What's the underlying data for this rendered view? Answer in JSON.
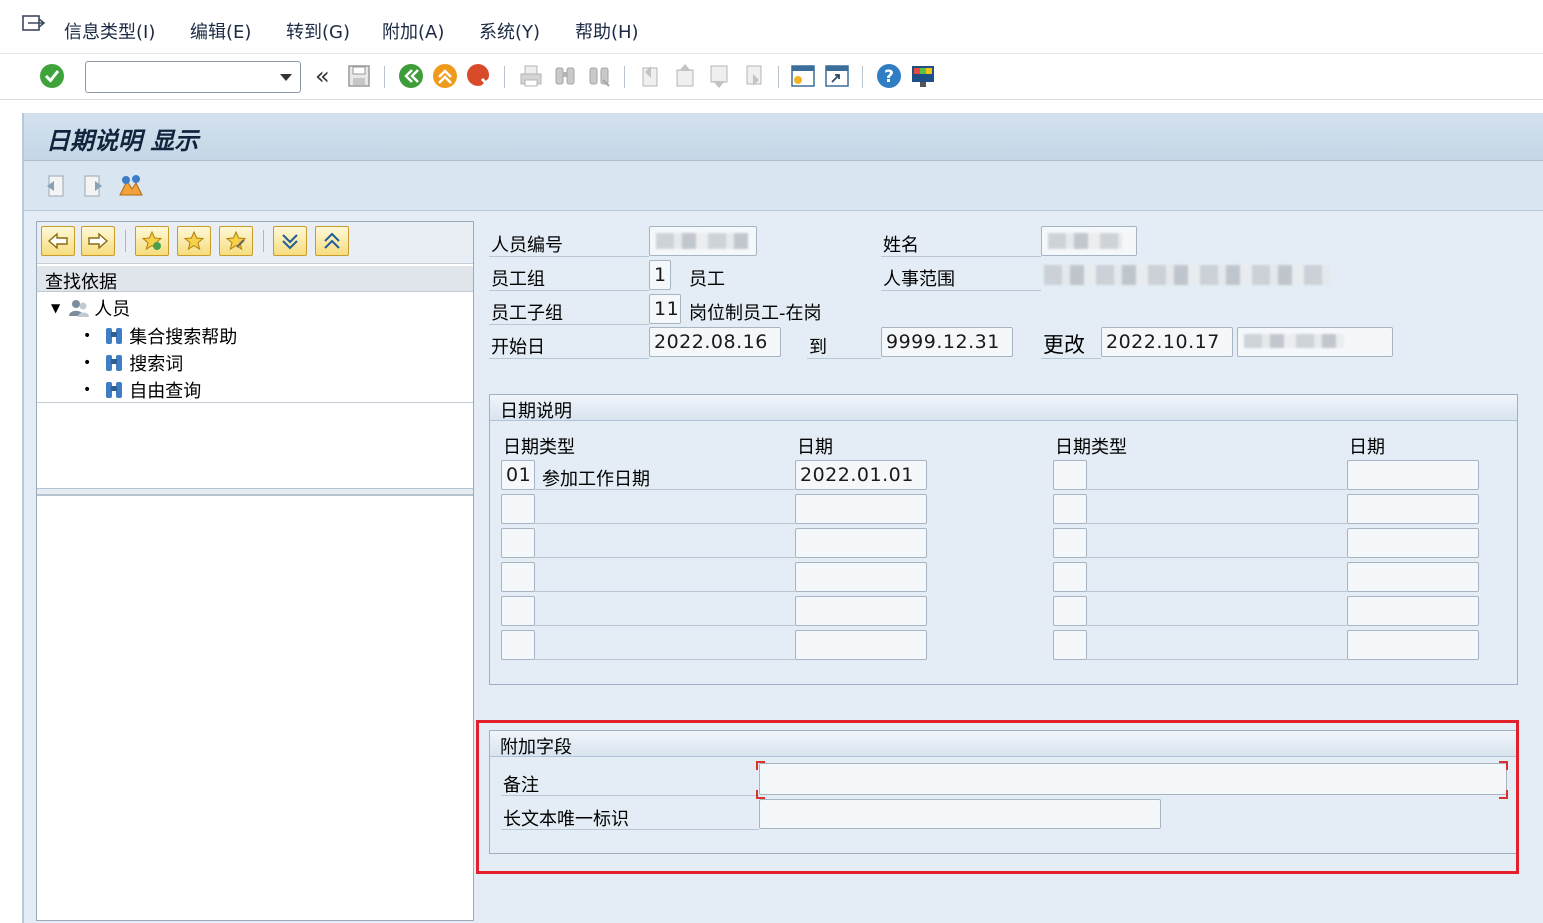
{
  "menubar": {
    "items": [
      "信息类型(I)",
      "编辑(E)",
      "转到(G)",
      "附加(A)",
      "系统(Y)",
      "帮助(H)"
    ]
  },
  "toolbar": {
    "command_field_value": "",
    "icons": [
      "enter-icon",
      "back-double-icon",
      "save-icon",
      "back-icon",
      "exit-icon",
      "cancel-icon",
      "print-icon",
      "find-icon",
      "find-next-icon",
      "first-page-icon",
      "prev-page-icon",
      "next-page-icon",
      "last-page-icon",
      "create-session-icon",
      "shortcut-icon",
      "help-icon",
      "customize-layout-icon"
    ]
  },
  "screen": {
    "title": "日期说明 显示"
  },
  "nav": {
    "tree_header": "查找依据",
    "root": "人员",
    "children": [
      "集合搜索帮助",
      "搜索词",
      "自由查询"
    ]
  },
  "header": {
    "personnel_no_label": "人员编号",
    "name_label": "姓名",
    "ee_group_label": "员工组",
    "ee_group_code": "1",
    "ee_group_text": "员工",
    "pers_area_label": "人事范围",
    "ee_subgroup_label": "员工子组",
    "ee_subgroup_code": "11",
    "ee_subgroup_text": "岗位制员工-在岗",
    "start_label": "开始日",
    "start_value": "2022.08.16",
    "to_label": "到",
    "end_value": "9999.12.31",
    "changed_label": "更改",
    "changed_value": "2022.10.17"
  },
  "dates_group": {
    "title": "日期说明",
    "col_type": "日期类型",
    "col_date": "日期",
    "rows": [
      {
        "type": "01",
        "type_text": "参加工作日期",
        "date": "2022.01.01"
      },
      {
        "type": "",
        "type_text": "",
        "date": ""
      },
      {
        "type": "",
        "type_text": "",
        "date": ""
      },
      {
        "type": "",
        "type_text": "",
        "date": ""
      },
      {
        "type": "",
        "type_text": "",
        "date": ""
      },
      {
        "type": "",
        "type_text": "",
        "date": ""
      }
    ]
  },
  "extra_group": {
    "title": "附加字段",
    "remark_label": "备注",
    "remark_value": "",
    "longtext_label": "长文本唯一标识",
    "longtext_value": ""
  }
}
